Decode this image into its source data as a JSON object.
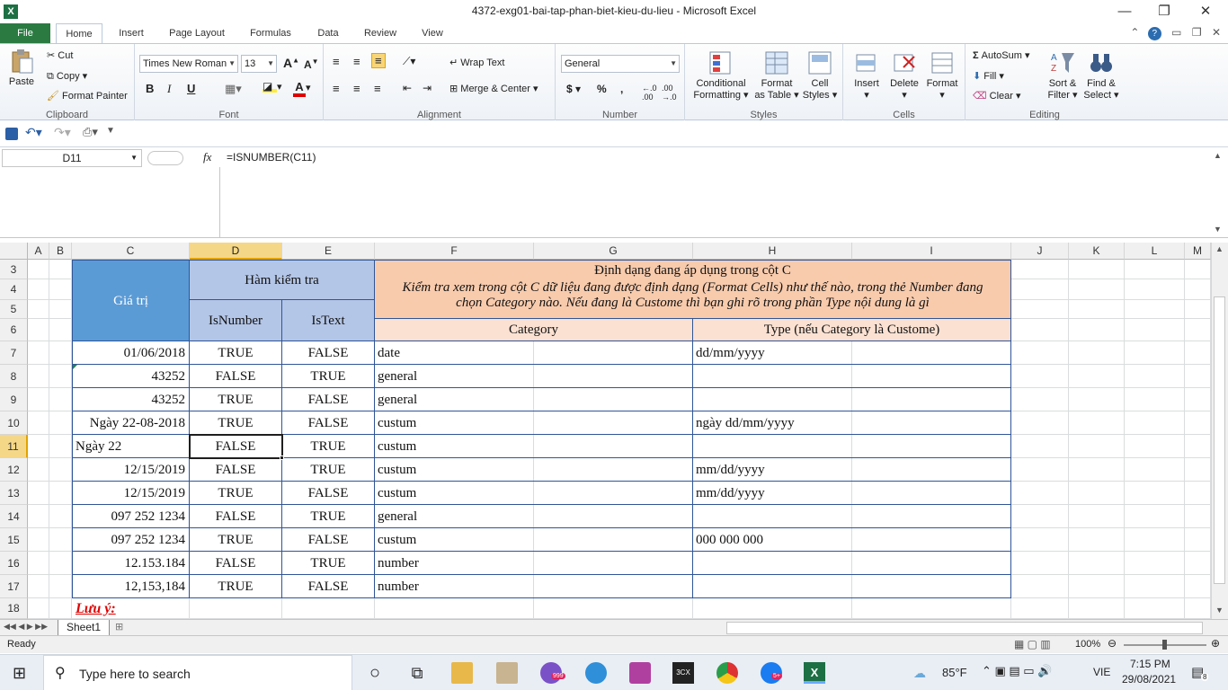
{
  "window": {
    "title": "4372-exg01-bai-tap-phan-biet-kieu-du-lieu  -  Microsoft Excel",
    "app_icon": "X",
    "minimize": "—",
    "restore": "❐",
    "close": "✕"
  },
  "tabs": [
    "File",
    "Home",
    "Insert",
    "Page Layout",
    "Formulas",
    "Data",
    "Review",
    "View"
  ],
  "ribbon": {
    "clipboard": {
      "paste": "Paste",
      "cut": "Cut",
      "copy": "Copy",
      "format_painter": "Format Painter",
      "label": "Clipboard"
    },
    "font": {
      "name": "Times New Roman",
      "size": "13",
      "label": "Font",
      "bold": "B",
      "italic": "I",
      "underline": "U"
    },
    "alignment": {
      "wrap": "Wrap Text",
      "merge": "Merge & Center",
      "label": "Alignment"
    },
    "number": {
      "format": "General",
      "label": "Number",
      "currency": "$",
      "percent": "%",
      "comma": ","
    },
    "styles": {
      "cond1": "Conditional",
      "cond2": "Formatting",
      "fat1": "Format",
      "fat2": "as Table",
      "cs1": "Cell",
      "cs2": "Styles",
      "label": "Styles"
    },
    "cells": {
      "insert": "Insert",
      "delete": "Delete",
      "format": "Format",
      "label": "Cells"
    },
    "editing": {
      "autosum": "AutoSum",
      "fill": "Fill",
      "clear": "Clear",
      "sort1": "Sort &",
      "sort2": "Filter",
      "find1": "Find &",
      "find2": "Select",
      "label": "Editing"
    }
  },
  "formula_bar": {
    "name_box": "D11",
    "fx": "fx",
    "formula": "=ISNUMBER(C11)"
  },
  "columns": [
    "A",
    "B",
    "C",
    "D",
    "E",
    "F",
    "G",
    "H",
    "I",
    "J",
    "K",
    "L",
    "M"
  ],
  "rows": [
    "3",
    "4",
    "5",
    "6",
    "7",
    "8",
    "9",
    "10",
    "11",
    "12",
    "13",
    "14",
    "15",
    "16",
    "17",
    "18"
  ],
  "table": {
    "header_value": "Giá trị",
    "header_func": "Hàm kiểm tra",
    "header_isnumber": "IsNumber",
    "header_istext": "IsText",
    "header_format": "Định dạng đang áp dụng trong cột C",
    "header_note1": "Kiểm tra xem trong cột C dữ liệu đang được định dạng (Format Cells) như thế nào, trong thẻ Number đang",
    "header_note2": "chọn Category nào. Nếu đang là Custome thì bạn ghi rõ trong phần Type nội dung là gì",
    "header_category": "Category",
    "header_type": "Type (nếu Category là Custome)",
    "rows": [
      {
        "value": "01/06/2018",
        "align": "right",
        "isnumber": "TRUE",
        "istext": "FALSE",
        "category": "date",
        "type": "dd/mm/yyyy"
      },
      {
        "value": "43252",
        "align": "right",
        "isnumber": "FALSE",
        "istext": "TRUE",
        "category": "general",
        "type": ""
      },
      {
        "value": "43252",
        "align": "right",
        "isnumber": "TRUE",
        "istext": "FALSE",
        "category": "general",
        "type": ""
      },
      {
        "value": "Ngày 22-08-2018",
        "align": "right",
        "isnumber": "TRUE",
        "istext": "FALSE",
        "category": "custum",
        "type": "ngày dd/mm/yyyy"
      },
      {
        "value": "Ngày 22",
        "align": "left",
        "isnumber": "FALSE",
        "istext": "TRUE",
        "category": "custum",
        "type": ""
      },
      {
        "value": "12/15/2019",
        "align": "right",
        "isnumber": "FALSE",
        "istext": "TRUE",
        "category": "custum",
        "type": "mm/dd/yyyy"
      },
      {
        "value": "12/15/2019",
        "align": "right",
        "isnumber": "TRUE",
        "istext": "FALSE",
        "category": "custum",
        "type": "mm/dd/yyyy"
      },
      {
        "value": "097 252 1234",
        "align": "right",
        "isnumber": "FALSE",
        "istext": "TRUE",
        "category": "general",
        "type": ""
      },
      {
        "value": "097 252 1234",
        "align": "right",
        "isnumber": "TRUE",
        "istext": "FALSE",
        "category": "custum",
        "type": "000 000 000"
      },
      {
        "value": "12.153.184",
        "align": "right",
        "isnumber": "FALSE",
        "istext": "TRUE",
        "category": "number",
        "type": ""
      },
      {
        "value": "12,153,184",
        "align": "right",
        "isnumber": "TRUE",
        "istext": "FALSE",
        "category": "number",
        "type": ""
      }
    ],
    "note_label": "Lưu ý:"
  },
  "sheet_tab": "Sheet1",
  "status": {
    "ready": "Ready",
    "zoom": "100%"
  },
  "taskbar": {
    "search_placeholder": "Type here to search",
    "weather": "85°F",
    "lang": "VIE",
    "time": "7:15 PM",
    "date": "29/08/2021",
    "notifications": "8",
    "viber_badge": "999",
    "zalo_badge": "5+"
  },
  "colors": {
    "excel_green": "#2a7a42",
    "header_blue": "#5b9bd5",
    "light_blue": "#b4c6e7",
    "orange": "#f8cbad",
    "border_blue": "#2f5597",
    "selection": "#f5d788"
  }
}
